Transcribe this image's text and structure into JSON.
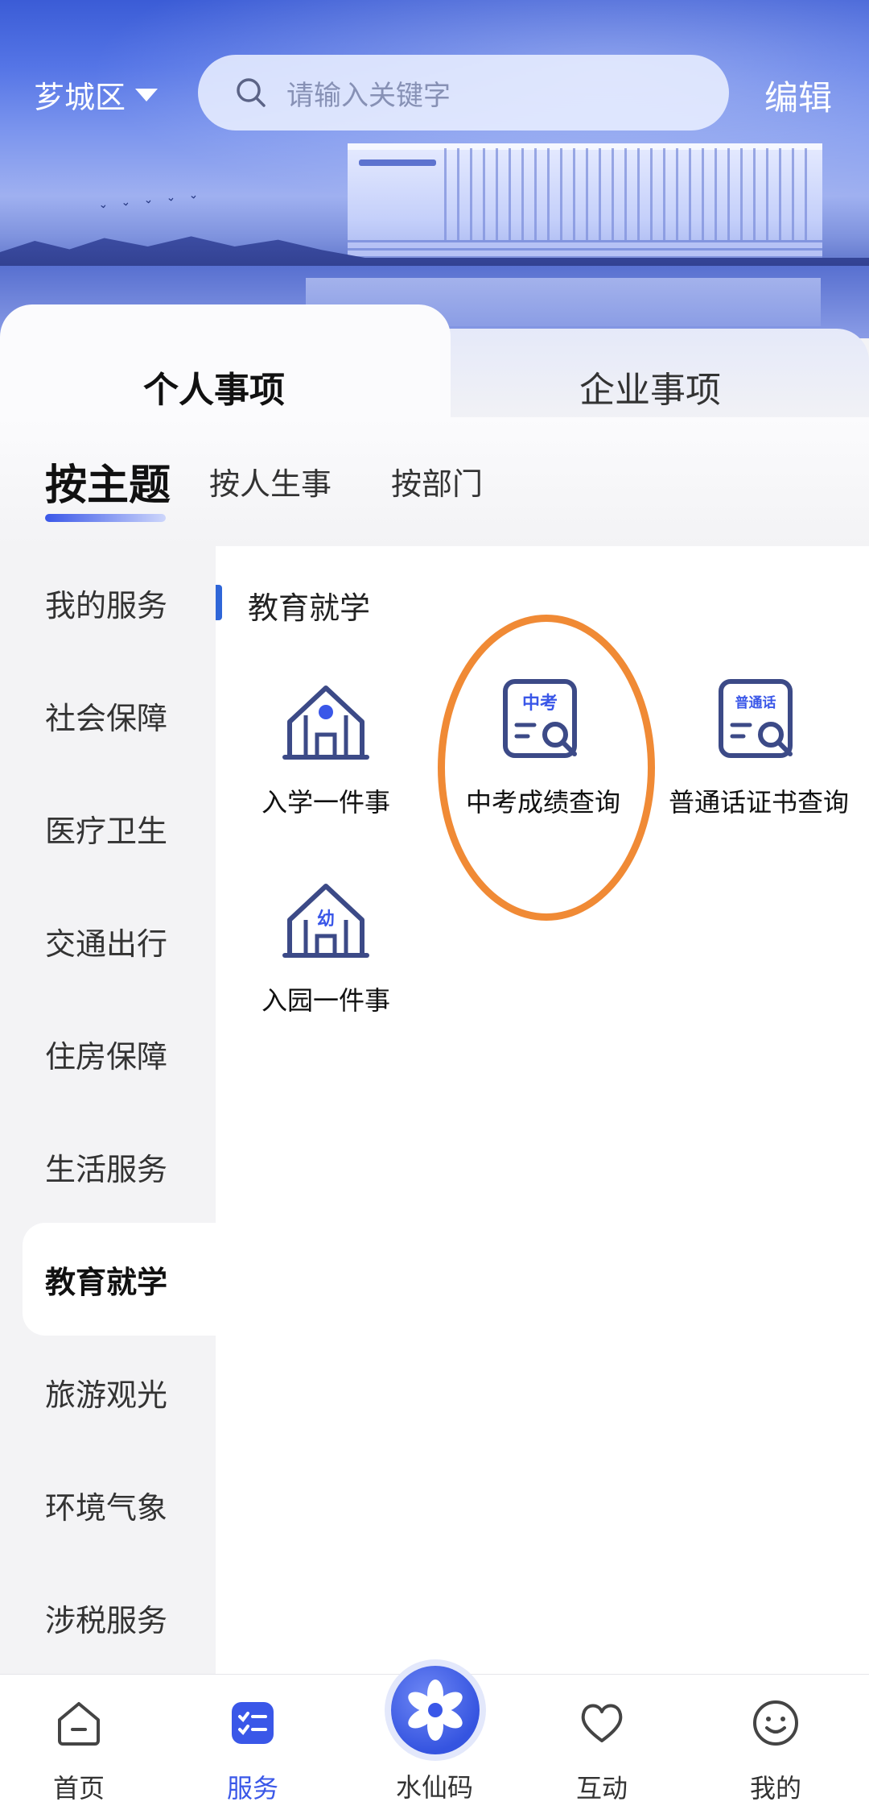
{
  "header": {
    "region": "芗城区",
    "search_placeholder": "请输入关键字",
    "edit_label": "编辑"
  },
  "tabs": {
    "personal": "个人事项",
    "company": "企业事项"
  },
  "subtabs": [
    "按主题",
    "按人生事",
    "按部门"
  ],
  "sidebar": {
    "items": [
      "我的服务",
      "社会保障",
      "医疗卫生",
      "交通出行",
      "住房保障",
      "生活服务",
      "教育就学",
      "旅游观光",
      "环境气象",
      "涉税服务"
    ],
    "active": "教育就学"
  },
  "content": {
    "section_title": "教育就学",
    "services": [
      {
        "label": "入学一件事",
        "icon": "school-building-icon"
      },
      {
        "label": "中考成绩查询",
        "icon": "exam-search-icon",
        "badge": "中考"
      },
      {
        "label": "普通话证书查询",
        "icon": "certificate-search-icon",
        "badge": "普通话"
      },
      {
        "label": "入园一件事",
        "icon": "kindergarten-icon",
        "badge": "幼"
      }
    ]
  },
  "bottom_nav": {
    "items": [
      {
        "label": "首页",
        "icon": "home-icon"
      },
      {
        "label": "服务",
        "icon": "service-list-icon"
      },
      {
        "label": "水仙码",
        "icon": "narcissus-code-icon"
      },
      {
        "label": "互动",
        "icon": "heart-icon"
      },
      {
        "label": "我的",
        "icon": "smile-profile-icon"
      }
    ],
    "active": "服务"
  },
  "colors": {
    "accent": "#3a57e8",
    "highlight_ring": "#f08a35",
    "icon_dark": "#3c4a87"
  }
}
